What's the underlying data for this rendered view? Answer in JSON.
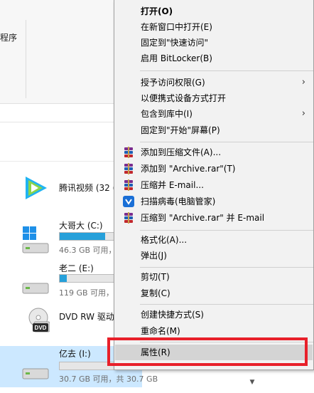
{
  "ribbon": {
    "partial_label": "程序"
  },
  "drives": [
    {
      "name": "腾讯视频 (32 (",
      "icon": "tencent-video-icon"
    },
    {
      "name": "大哥大 (C:)",
      "space": "46.3 GB 可用，",
      "used_fraction": 0.52,
      "icon": "windows-drive-icon"
    },
    {
      "name": "老二 (E:)",
      "space": "119 GB 可用，",
      "used_fraction": 0.08,
      "icon": "hard-drive-icon"
    },
    {
      "name": "DVD RW 驱动",
      "icon": "dvd-drive-icon",
      "icon_text": "DVD"
    },
    {
      "name": "亿去 (I:)",
      "space": "30.7 GB 可用，共 30.7 GB",
      "used_fraction": 0.0,
      "icon": "hard-drive-icon",
      "selected": true
    }
  ],
  "menu": {
    "items": [
      {
        "label": "打开(O)",
        "bold": true
      },
      {
        "label": "在新窗口中打开(E)"
      },
      {
        "label": "固定到\"快速访问\""
      },
      {
        "label": "启用 BitLocker(B)"
      },
      {
        "label": "授予访问权限(G)",
        "submenu": true
      },
      {
        "label": "以便携式设备方式打开"
      },
      {
        "label": "包含到库中(I)",
        "submenu": true
      },
      {
        "label": "固定到\"开始\"屏幕(P)"
      },
      {
        "label": "添加到压缩文件(A)...",
        "icon": "winrar-icon"
      },
      {
        "label": "添加到 \"Archive.rar\"(T)",
        "icon": "winrar-icon"
      },
      {
        "label": "压缩并 E-mail...",
        "icon": "winrar-icon"
      },
      {
        "label": "扫描病毒(电脑管家)",
        "icon": "shield-icon"
      },
      {
        "label": "压缩到 \"Archive.rar\" 并 E-mail",
        "icon": "winrar-icon"
      },
      {
        "label": "格式化(A)..."
      },
      {
        "label": "弹出(J)"
      },
      {
        "label": "剪切(T)"
      },
      {
        "label": "复制(C)"
      },
      {
        "label": "创建快捷方式(S)"
      },
      {
        "label": "重命名(M)"
      },
      {
        "label": "属性(R)",
        "hovered": true
      }
    ],
    "submenu_arrow": "›"
  },
  "colors": {
    "highlight": "#e8202a",
    "selection": "#cce8ff",
    "bar_fill": "#26a0da"
  },
  "scroll_arrow": "▼"
}
